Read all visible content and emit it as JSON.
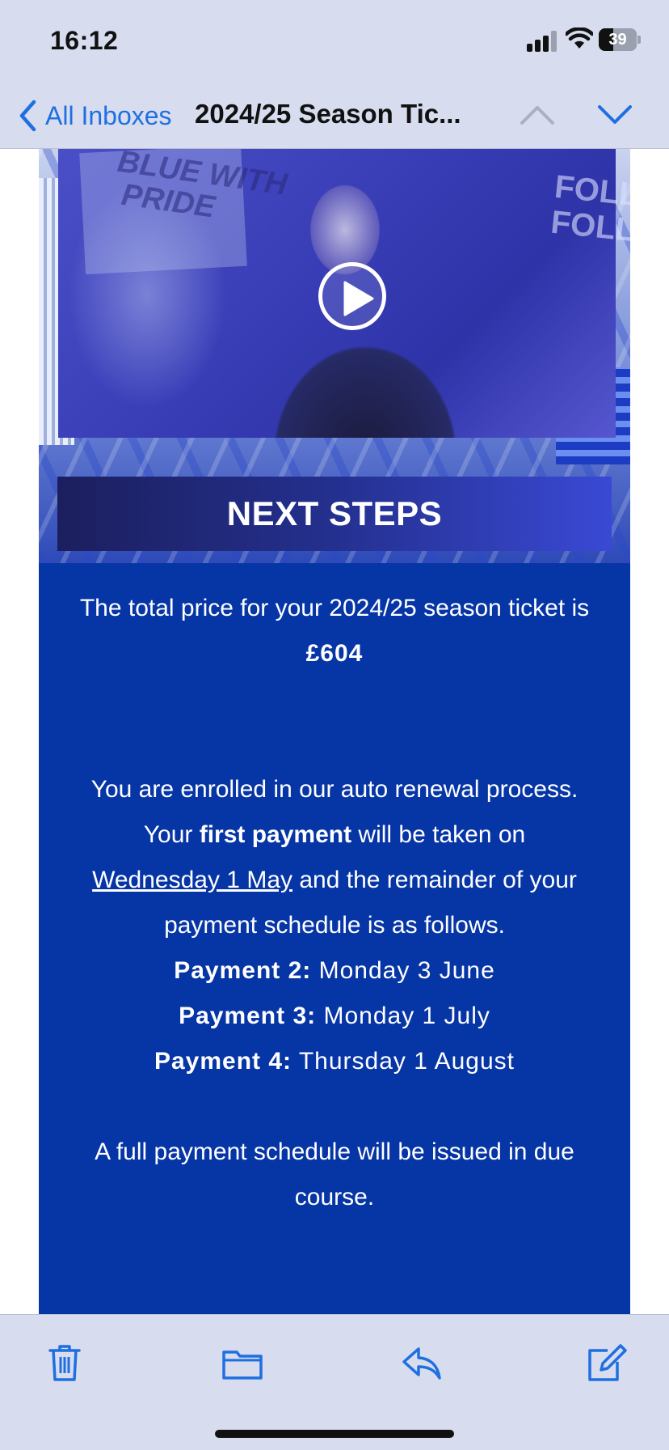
{
  "status_bar": {
    "time": "16:12",
    "battery": "39",
    "battery_level": 0.39
  },
  "nav": {
    "back_label": "All Inboxes",
    "subject": "2024/25 Season Tic..."
  },
  "hero": {
    "banner_title": "NEXT STEPS"
  },
  "body": {
    "total_line": "The total price for your 2024/25 season ticket is",
    "total_price": "£604",
    "enrol_line1": "You are enrolled in our auto renewal process.",
    "enrol_pre": "Your ",
    "enrol_bold": "first payment",
    "enrol_post": " will be taken on",
    "enrol_date": "Wednesday 1 May",
    "enrol_rest": " and the remainder of your payment schedule is as follows.",
    "payments": [
      {
        "label": "Payment 2:",
        "date": " Monday 3 June"
      },
      {
        "label": "Payment 3:",
        "date": " Monday 1 July"
      },
      {
        "label": "Payment 4:",
        "date": " Thursday 1 August"
      }
    ],
    "footer_note": "A full payment schedule will be issued in due course."
  },
  "colors": {
    "accent": "#1f6fe0",
    "panel": "#0635a6",
    "chrome": "#d7ddef"
  }
}
